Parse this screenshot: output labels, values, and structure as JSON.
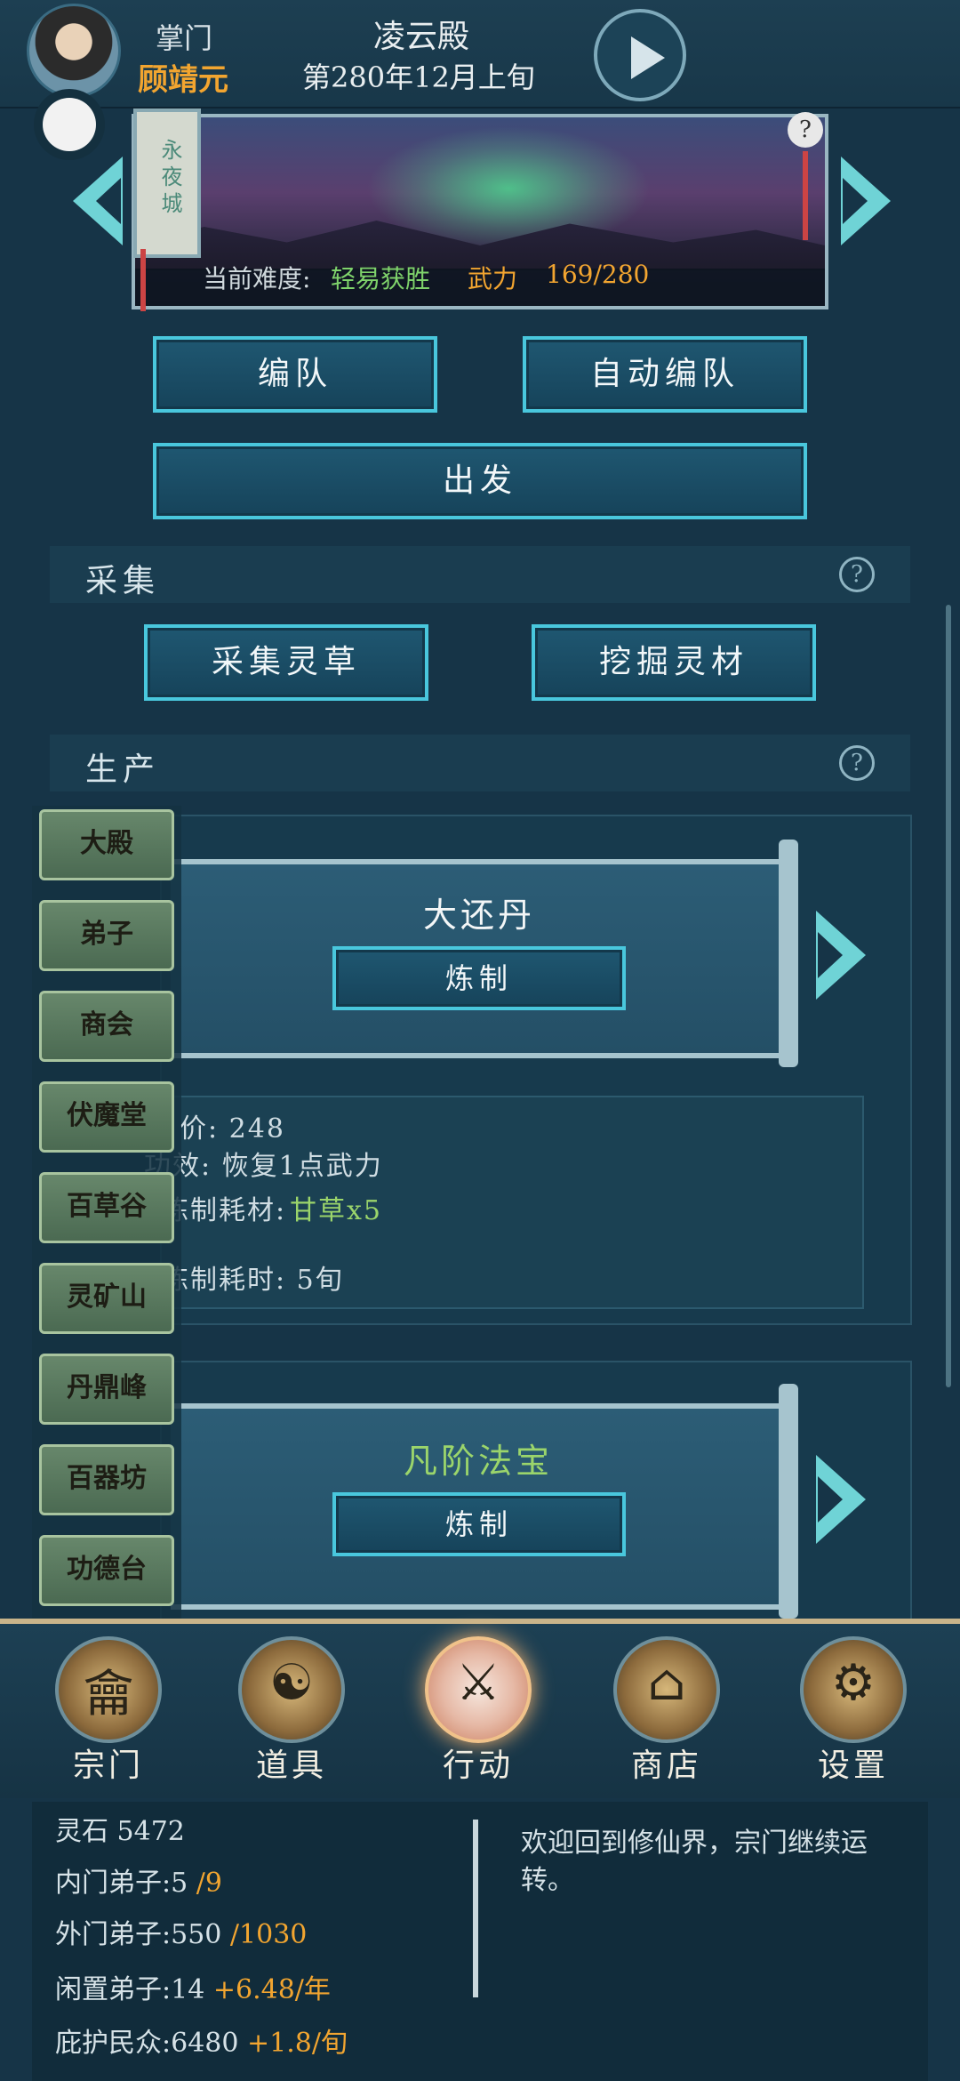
{
  "header": {
    "title_label": "掌门",
    "leader_name": "顾靖元",
    "sect_name": "凌云殿",
    "date": "第280年12月上旬"
  },
  "banner": {
    "city_name": "永夜城",
    "difficulty_label": "当前难度:",
    "difficulty_value": "轻易获胜",
    "force_label": "武力",
    "force_value": "169/280",
    "help_symbol": "?"
  },
  "actions": {
    "team": "编队",
    "auto_team": "自动编队",
    "depart": "出发"
  },
  "gather": {
    "title": "采集",
    "help_symbol": "?",
    "herb": "采集灵草",
    "mine": "挖掘灵材"
  },
  "produce": {
    "title": "生产",
    "help_symbol": "?",
    "cards": [
      {
        "name": "大还丹",
        "craft": "炼制",
        "info": {
          "price": "价: 248",
          "effect": "功效: 恢复1点武力",
          "material_label": "炼制耗材:",
          "material_value": "甘草x5",
          "time": "炼制耗时: 5旬"
        }
      },
      {
        "name": "凡阶法宝",
        "craft": "炼制"
      }
    ]
  },
  "side_nav": [
    "大殿",
    "弟子",
    "商会",
    "伏魔堂",
    "百草谷",
    "灵矿山",
    "丹鼎峰",
    "百器坊",
    "功德台"
  ],
  "tabs": [
    {
      "label": "宗门",
      "icon": "gate-icon",
      "glyph": "龠"
    },
    {
      "label": "道具",
      "icon": "bag-icon",
      "glyph": "☯"
    },
    {
      "label": "行动",
      "icon": "sword-cloud-icon",
      "glyph": "⚔"
    },
    {
      "label": "商店",
      "icon": "shop-icon",
      "glyph": "⌂"
    },
    {
      "label": "设置",
      "icon": "gear-icon",
      "glyph": "⚙"
    }
  ],
  "status": {
    "stone_label": "灵石",
    "stone_value": "5472",
    "inner_label": "内门弟子:",
    "inner_value": "5",
    "inner_cap": "/9",
    "outer_label": "外门弟子:",
    "outer_value": "550",
    "outer_cap": "/1030",
    "idle_label": "闲置弟子:",
    "idle_value": "14",
    "idle_rate": "+6.48/年",
    "people_label": "庇护民众:",
    "people_value": "6480",
    "people_rate": "+1.8/旬"
  },
  "message": "欢迎回到修仙界，宗门继续运转。",
  "colors": {
    "accent_cyan": "#49c7dd",
    "gold": "#f2a530",
    "green": "#9bd56b",
    "background": "#163447"
  }
}
